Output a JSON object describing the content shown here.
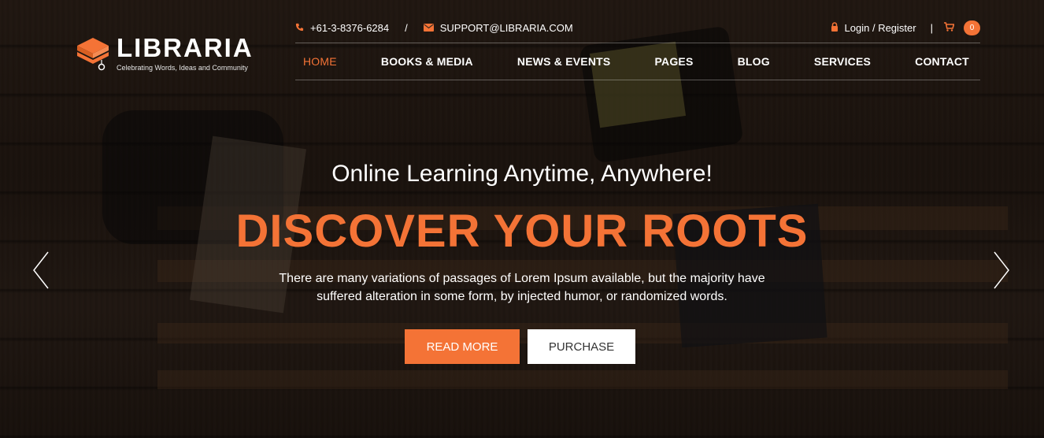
{
  "brand": {
    "name": "LIBRARIA",
    "tagline": "Celebrating Words, Ideas and Community",
    "accent_color": "#f47336"
  },
  "topbar": {
    "phone": "+61-3-8376-6284",
    "separator": "/",
    "email": "SUPPORT@LIBRARIA.COM",
    "login": "Login / Register",
    "divider": "|",
    "cart_count": "0",
    "icons": [
      "phone-icon",
      "envelope-icon",
      "lock-icon",
      "cart-icon"
    ]
  },
  "nav": {
    "items": [
      {
        "label": "HOME",
        "active": true
      },
      {
        "label": "BOOKS & MEDIA",
        "active": false
      },
      {
        "label": "NEWS & EVENTS",
        "active": false
      },
      {
        "label": "PAGES",
        "active": false
      },
      {
        "label": "BLOG",
        "active": false
      },
      {
        "label": "SERVICES",
        "active": false
      },
      {
        "label": "CONTACT",
        "active": false
      }
    ]
  },
  "slide": {
    "subtitle": "Online Learning Anytime, Anywhere!",
    "title": "DISCOVER YOUR ROOTS",
    "description_line1": "There are many variations of passages of Lorem Ipsum available, but the majority have",
    "description_line2": "suffered alteration in some form, by injected humor, or randomized words.",
    "primary_button": "READ MORE",
    "secondary_button": "PURCHASE",
    "prev_icon": "chevron-left-icon",
    "next_icon": "chevron-right-icon"
  }
}
